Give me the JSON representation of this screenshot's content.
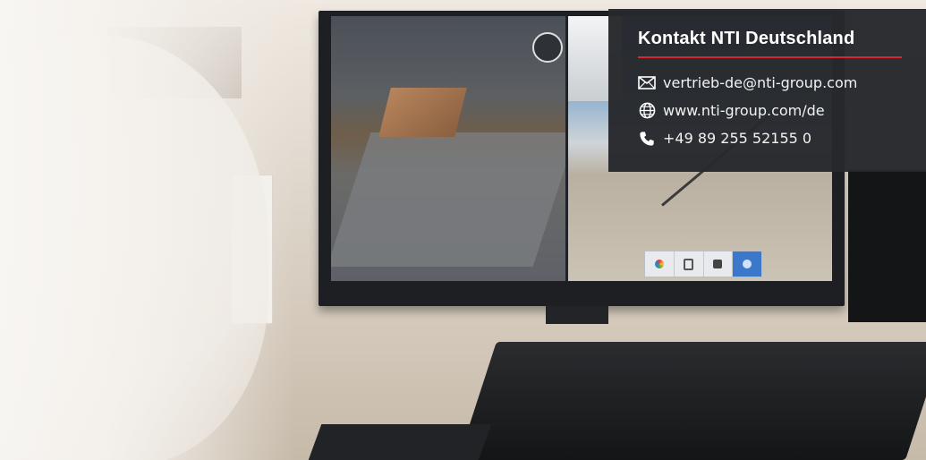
{
  "contact_box": {
    "title": "Kontakt NTI Deutschland",
    "accent_color": "#d8262e",
    "items": [
      {
        "icon": "envelope-icon",
        "text": "vertrieb-de@nti-group.com"
      },
      {
        "icon": "globe-icon",
        "text": "www.nti-group.com/de"
      },
      {
        "icon": "phone-icon",
        "text": "+49 89 255 52155 0"
      }
    ]
  },
  "photo": {
    "description_icons": [
      "monitor",
      "laptop",
      "keyboard"
    ]
  }
}
